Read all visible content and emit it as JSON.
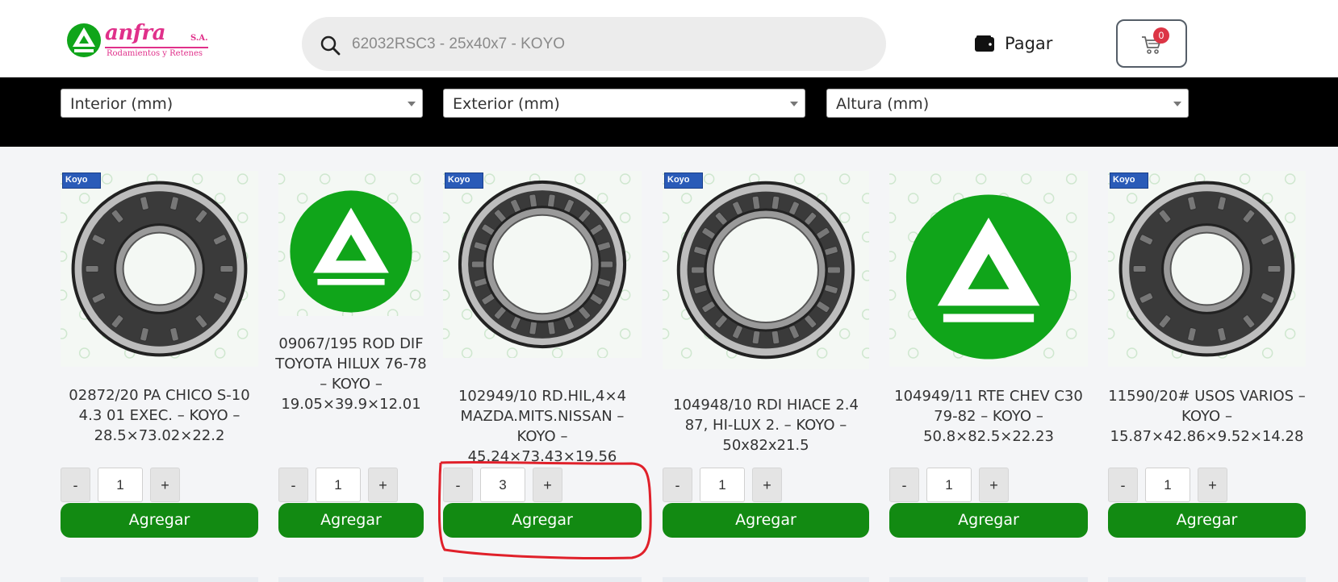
{
  "header": {
    "logo": {
      "brand": "anfra",
      "sa": "S.A.",
      "tagline": "Rodamientos y Retenes"
    },
    "search": {
      "placeholder": "62032RSC3 - 25x40x7 - KOYO"
    },
    "pay_label": "Pagar",
    "cart_count": "0"
  },
  "filters": [
    {
      "label": "Interior (mm)"
    },
    {
      "label": "Exterior (mm)"
    },
    {
      "label": "Altura (mm)"
    }
  ],
  "colors": {
    "brand_green": "#128a12",
    "brand_pink": "#e0308a",
    "badge_red": "#dc3545",
    "highlight_red": "#e0202a"
  },
  "products": [
    {
      "title": "02872/20 PA CHICO S-10 4.3 01 EXEC. – KOYO – 28.5×73.02×22.2",
      "image": "koyo-bearing-icon",
      "qty_minus": "-",
      "qty": "1",
      "qty_plus": "+",
      "add_label": "Agregar"
    },
    {
      "title": "09067/195 ROD DIF TOYOTA HILUX 76-78 – KOYO – 19.05×39.9×12.01",
      "image": "anfra-logo-icon",
      "qty_minus": "-",
      "qty": "1",
      "qty_plus": "+",
      "add_label": "Agregar"
    },
    {
      "title": "102949/10 RD.HIL,4×4 MAZDA.MITS.NISSAN – KOYO – 45.24×73.43×19.56",
      "image": "koyo-tapered-bearing-icon",
      "qty_minus": "-",
      "qty": "3",
      "qty_plus": "+",
      "add_label": "Agregar"
    },
    {
      "title": "104948/10 RDI HIACE 2.4 87, HI-LUX 2. – KOYO – 50x82x21.5",
      "image": "koyo-tapered-bearing-icon",
      "qty_minus": "-",
      "qty": "1",
      "qty_plus": "+",
      "add_label": "Agregar"
    },
    {
      "title": "104949/11 RTE CHEV C30 79-82 – KOYO – 50.8×82.5×22.23",
      "image": "anfra-logo-icon",
      "qty_minus": "-",
      "qty": "1",
      "qty_plus": "+",
      "add_label": "Agregar"
    },
    {
      "title": "11590/20# USOS VARIOS – KOYO – 15.87×42.86×9.52×14.28",
      "image": "koyo-bearing-icon",
      "qty_minus": "-",
      "qty": "1",
      "qty_plus": "+",
      "add_label": "Agregar"
    }
  ]
}
